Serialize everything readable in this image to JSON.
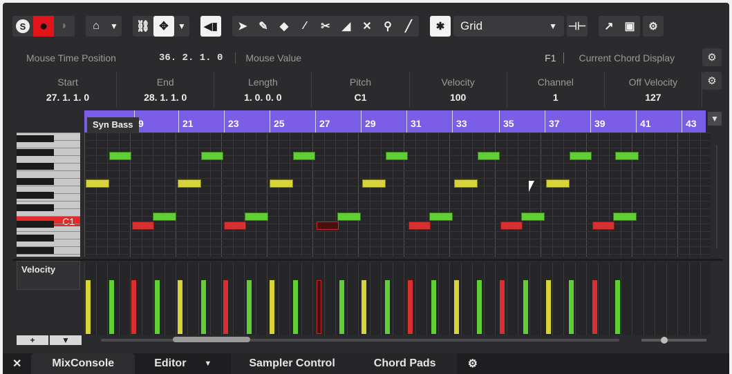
{
  "toolbar": {
    "solo_label": "S",
    "record_glyph": "●",
    "grid_mode": "Grid"
  },
  "infoline": {
    "mouse_time_label": "Mouse Time Position",
    "mouse_time_value": "36. 2. 1.   0",
    "mouse_value_label": "Mouse Value",
    "f1_label": "F1",
    "chord_label": "Current Chord Display"
  },
  "eventinfo": {
    "columns": [
      {
        "label": "Start",
        "value": "27. 1. 1.   0"
      },
      {
        "label": "End",
        "value": "28. 1. 1.   0"
      },
      {
        "label": "Length",
        "value": "1. 0. 0.   0"
      },
      {
        "label": "Pitch",
        "value": "C1"
      },
      {
        "label": "Velocity",
        "value": "100"
      },
      {
        "label": "Channel",
        "value": "1"
      },
      {
        "label": "Off Velocity",
        "value": "127"
      }
    ]
  },
  "ruler": {
    "part_name": "Syn Bass",
    "bars": [
      "9",
      "21",
      "23",
      "25",
      "27",
      "29",
      "31",
      "33",
      "35",
      "37",
      "39",
      "41",
      "43"
    ]
  },
  "keyboard": {
    "c1_label": "C1"
  },
  "velocity_lane": {
    "label": "Velocity"
  },
  "bottom": {
    "add_label": "+",
    "menu_label": "▼"
  },
  "tabs": [
    {
      "label": "MixConsole"
    },
    {
      "label": "Editor"
    },
    {
      "label": "Sampler Control"
    },
    {
      "label": "Chord Pads"
    }
  ],
  "colors": {
    "accent_ruler": "#7b5ee8",
    "note_yellow": "#d7d43a",
    "note_green": "#5fcf34",
    "note_red": "#d83030",
    "record_red": "#e0141a"
  }
}
